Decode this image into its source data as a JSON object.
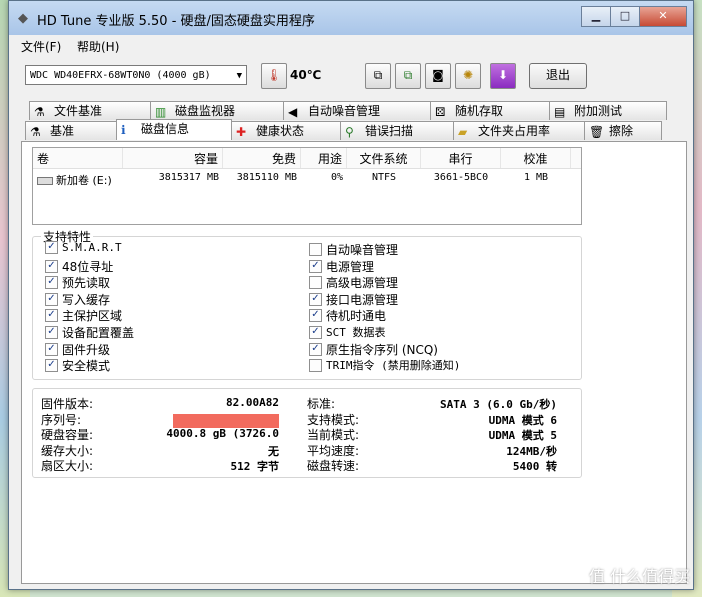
{
  "window": {
    "title": "HD Tune 专业版 5.50 - 硬盘/固态硬盘实用程序",
    "minimize": "▁",
    "maximize": "□",
    "close": "✕"
  },
  "menu": [
    "文件(F)",
    "帮助(H)"
  ],
  "toolbar": {
    "drive": "WDC WD40EFRX-68WT0N0 (4000 gB)",
    "temperature": "40℃",
    "exit_label": "退出"
  },
  "tabs_top": [
    "文件基准",
    "磁盘监视器",
    "自动噪音管理",
    "随机存取",
    "附加测试"
  ],
  "tabs_bottom": [
    "基准",
    "磁盘信息",
    "健康状态",
    "错误扫描",
    "文件夹占用率",
    "擦除"
  ],
  "active_tab": "磁盘信息",
  "volumes": {
    "columns": [
      "卷",
      "容量",
      "免费",
      "用途",
      "文件系统",
      "串行",
      "校准"
    ],
    "rows": [
      [
        "新加卷 (E:)",
        "3815317 MB",
        "3815110 MB",
        "0%",
        "NTFS",
        "3661-5BC0",
        "1 MB"
      ]
    ]
  },
  "features": {
    "title": "支持特性",
    "left": [
      {
        "label": "S.M.A.R.T",
        "checked": true
      },
      {
        "label": "48位寻址",
        "checked": true
      },
      {
        "label": "预先读取",
        "checked": true
      },
      {
        "label": "写入缓存",
        "checked": true
      },
      {
        "label": "主保护区域",
        "checked": true
      },
      {
        "label": "设备配置覆盖",
        "checked": true
      },
      {
        "label": "固件升级",
        "checked": true
      },
      {
        "label": "安全模式",
        "checked": true
      }
    ],
    "right": [
      {
        "label": "自动噪音管理",
        "checked": false
      },
      {
        "label": "电源管理",
        "checked": true
      },
      {
        "label": "高级电源管理",
        "checked": false
      },
      {
        "label": "接口电源管理",
        "checked": true
      },
      {
        "label": "待机时通电",
        "checked": true
      },
      {
        "label": "SCT 数据表",
        "checked": true
      },
      {
        "label": "原生指令序列 (NCQ)",
        "checked": true
      },
      {
        "label": "TRIM指令 (禁用删除通知)",
        "checked": false
      }
    ]
  },
  "info": {
    "left": [
      {
        "label": "固件版本:",
        "value": "82.00A82"
      },
      {
        "label": "序列号:",
        "value": ""
      },
      {
        "label": "硬盘容量:",
        "value": "4000.8 gB (3726.0"
      },
      {
        "label": "缓存大小:",
        "value": "无"
      },
      {
        "label": "扇区大小:",
        "value": "512 字节"
      }
    ],
    "right": [
      {
        "label": "标准:",
        "value": "SATA 3 (6.0 Gb/秒)"
      },
      {
        "label": "支持模式:",
        "value": "UDMA 模式 6"
      },
      {
        "label": "当前模式:",
        "value": "UDMA 模式 5"
      },
      {
        "label": "平均速度:",
        "value": "124MB/秒"
      },
      {
        "label": "磁盘转速:",
        "value": "5400 转"
      }
    ]
  },
  "watermark": "值 什么值得买",
  "colors": {
    "redaction": "#f26b5e",
    "check": "#1a3c8a"
  },
  "icons": {
    "file-benchmark": "flask",
    "disk-monitor": "bar-chart",
    "aam": "speaker",
    "random-access": "dice",
    "extra-tests": "clipboard",
    "benchmark": "flask",
    "disk-info": "info",
    "health": "cross",
    "error-scan": "magnifier",
    "folder-usage": "folder",
    "erase": "trash"
  }
}
